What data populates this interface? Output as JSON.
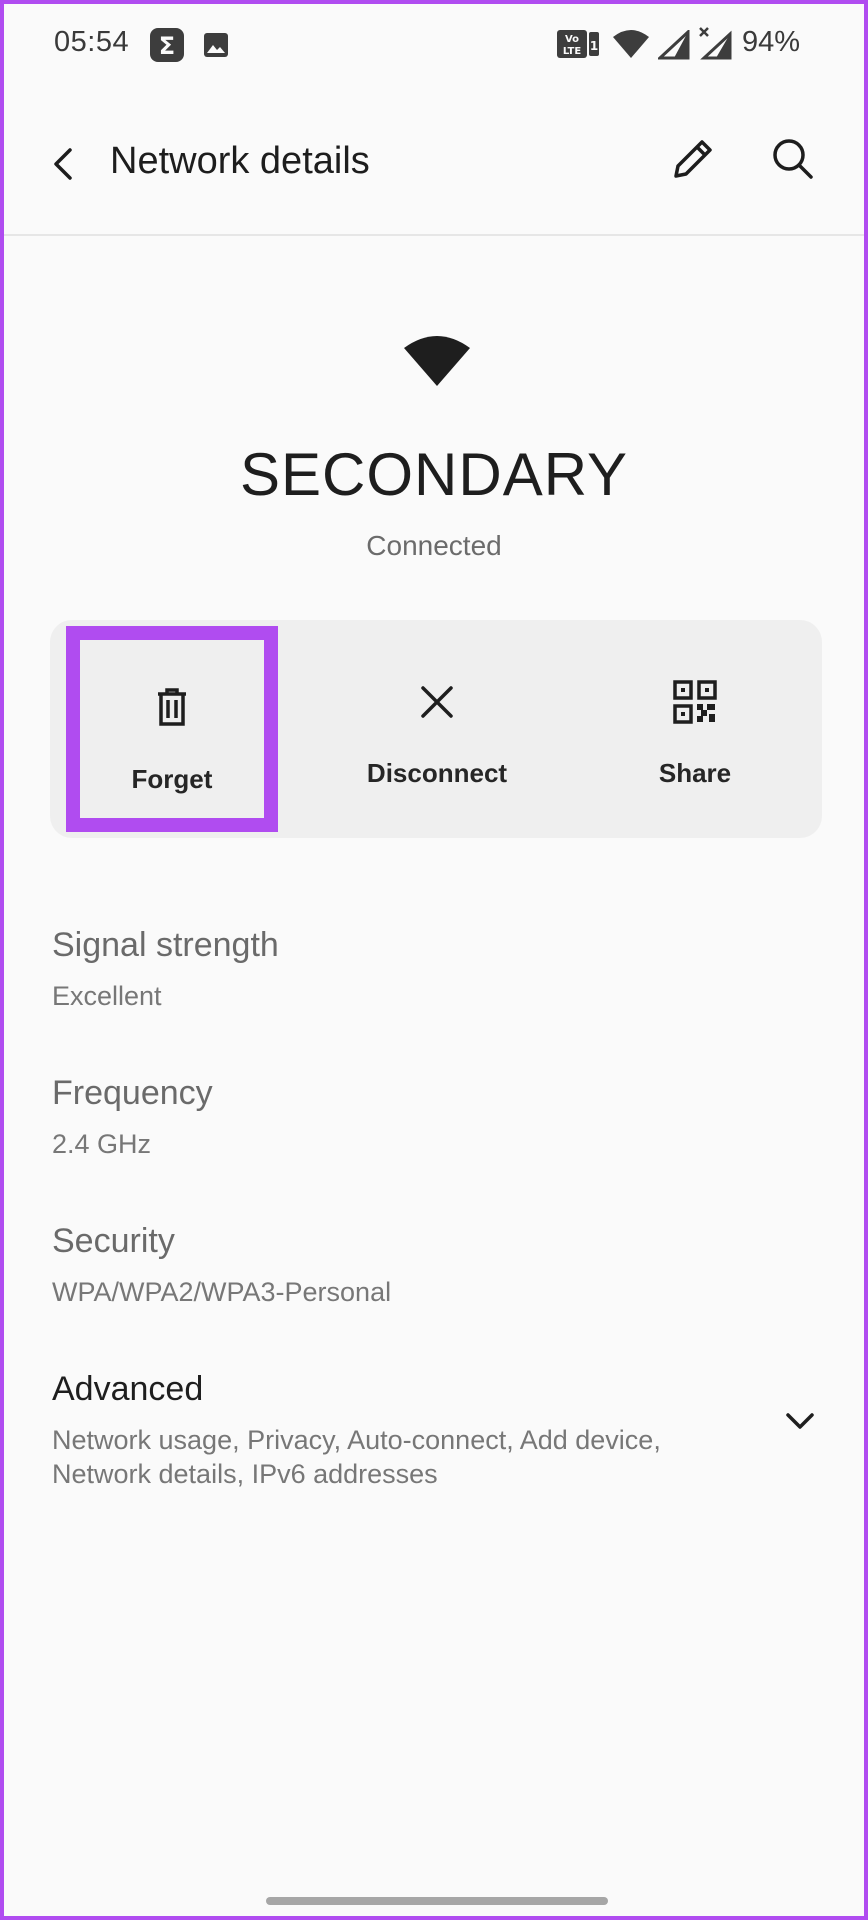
{
  "status_bar": {
    "time": "05:54",
    "battery": "94%",
    "icons": [
      "sigma-notification-icon",
      "gallery-notification-icon",
      "volte-icon",
      "wifi-status-icon",
      "cell-signal-icon",
      "cell-signal-no-data-icon"
    ]
  },
  "app_bar": {
    "title": "Network details",
    "back_icon": "back-arrow-icon",
    "edit_icon": "pencil-icon",
    "search_icon": "search-icon"
  },
  "network": {
    "name": "SECONDARY",
    "status": "Connected",
    "icon": "wifi-icon"
  },
  "actions": [
    {
      "label": "Forget",
      "icon": "trash-icon"
    },
    {
      "label": "Disconnect",
      "icon": "close-icon"
    },
    {
      "label": "Share",
      "icon": "qr-code-icon"
    }
  ],
  "details": [
    {
      "title": "Signal strength",
      "value": "Excellent"
    },
    {
      "title": "Frequency",
      "value": "2.4 GHz"
    },
    {
      "title": "Security",
      "value": "WPA/WPA2/WPA3-Personal"
    }
  ],
  "advanced": {
    "title": "Advanced",
    "summary": "Network usage, Privacy, Auto-connect, Add device, Network details, IPv6 addresses",
    "icon": "chevron-down-icon"
  },
  "colors": {
    "highlight": "#b04cf0",
    "background": "#fafafa",
    "card": "#efefef"
  }
}
